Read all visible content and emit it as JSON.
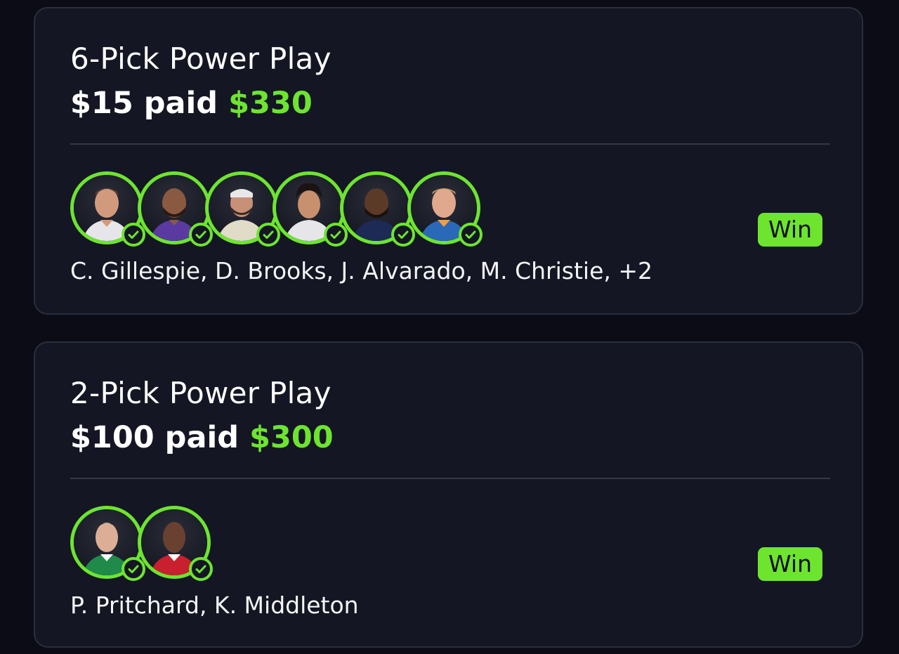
{
  "colors": {
    "background": "#0b0c16",
    "card": "#141623",
    "card_border": "#2b2e3b",
    "accent_green": "#6de52f",
    "text": "#ffffff"
  },
  "entries": [
    {
      "title": "6-Pick Power Play",
      "paid_amount": "$15",
      "paid_label": "paid",
      "payout": "$330",
      "players_summary": "C. Gillespie, D. Brooks, J. Alvarado, M. Christie, +2",
      "result": "Win",
      "avatar_icons": [
        "player-photo-icon",
        "player-photo-icon",
        "player-photo-icon",
        "player-photo-icon",
        "player-photo-icon",
        "player-photo-icon"
      ],
      "status_icon": "checkmark-circle-icon"
    },
    {
      "title": "2-Pick Power Play",
      "paid_amount": "$100",
      "paid_label": "paid",
      "payout": "$300",
      "players_summary": "P. Pritchard, K. Middleton",
      "result": "Win",
      "avatar_icons": [
        "player-photo-icon",
        "player-photo-icon"
      ],
      "status_icon": "checkmark-circle-icon"
    }
  ]
}
